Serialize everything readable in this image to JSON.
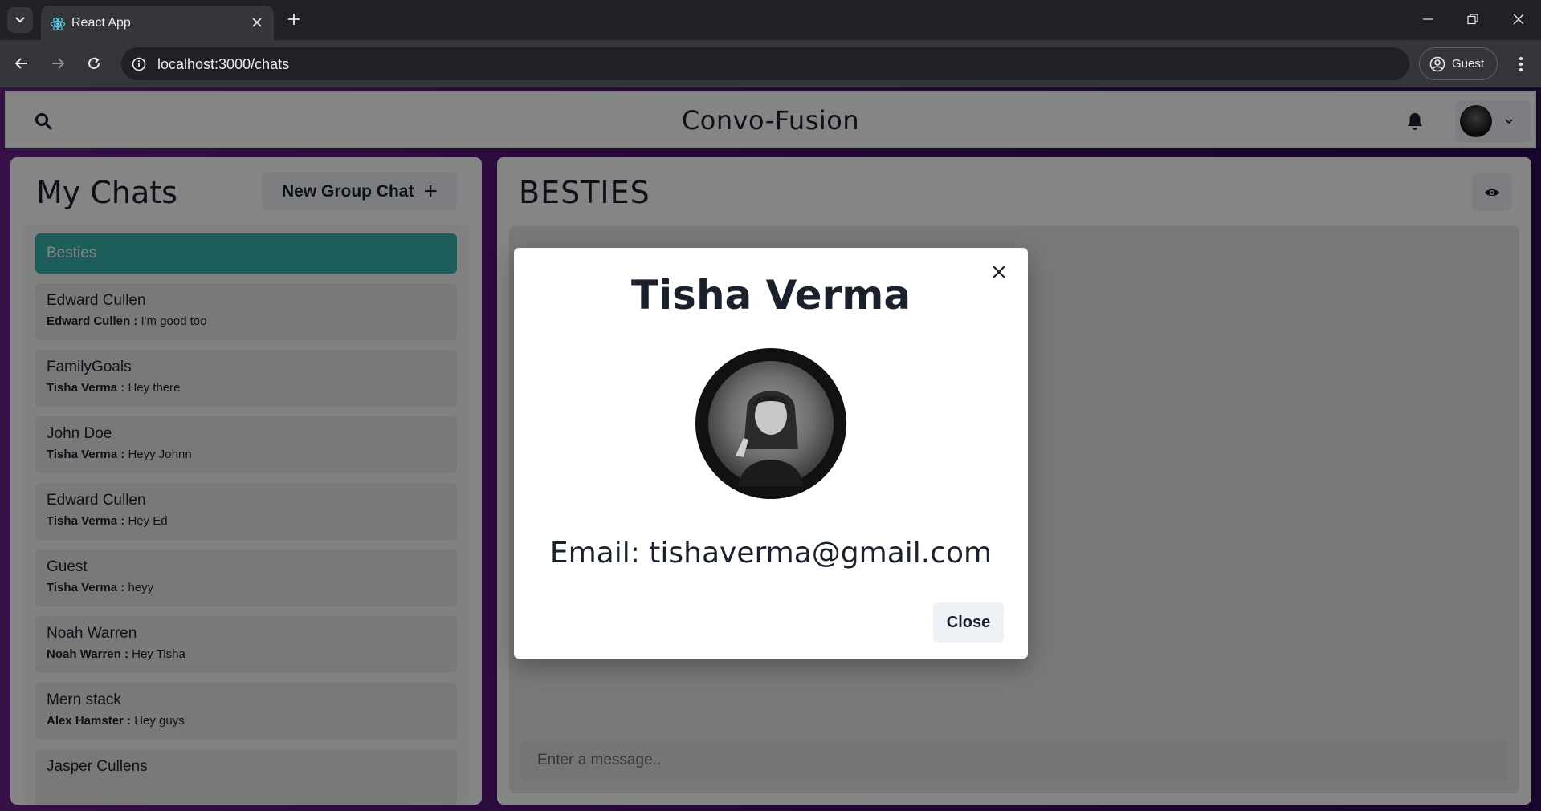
{
  "browser": {
    "tab_title": "React App",
    "url": "localhost:3000/chats",
    "profile_label": "Guest"
  },
  "header": {
    "brand": "Convo-Fusion"
  },
  "sidebar": {
    "title": "My Chats",
    "new_group_label": "New Group Chat",
    "chats": [
      {
        "name": "Besties",
        "sender": "",
        "message": "",
        "active": true
      },
      {
        "name": "Edward Cullen",
        "sender": "Edward Cullen :",
        "message": "I'm good too"
      },
      {
        "name": "FamilyGoals",
        "sender": "Tisha Verma :",
        "message": "Hey there"
      },
      {
        "name": "John Doe",
        "sender": "Tisha Verma :",
        "message": "Heyy Johnn"
      },
      {
        "name": "Edward Cullen",
        "sender": "Tisha Verma :",
        "message": "Hey Ed"
      },
      {
        "name": "Guest",
        "sender": "Tisha Verma :",
        "message": "heyy"
      },
      {
        "name": "Noah Warren",
        "sender": "Noah Warren :",
        "message": "Hey Tisha"
      },
      {
        "name": "Mern stack",
        "sender": "Alex Hamster :",
        "message": "Hey guys"
      },
      {
        "name": "Jasper Cullens",
        "sender": "",
        "message": ""
      }
    ]
  },
  "chat": {
    "title": "BESTIES",
    "input_placeholder": "Enter a message.."
  },
  "modal": {
    "name": "Tisha Verma",
    "email_text": "Email: tishaverma@gmail.com",
    "close_label": "Close"
  },
  "colors": {
    "active_chat": "#38b2ac",
    "background_gradient_start": "#6a1f8a",
    "background_gradient_end": "#2c0a52"
  }
}
